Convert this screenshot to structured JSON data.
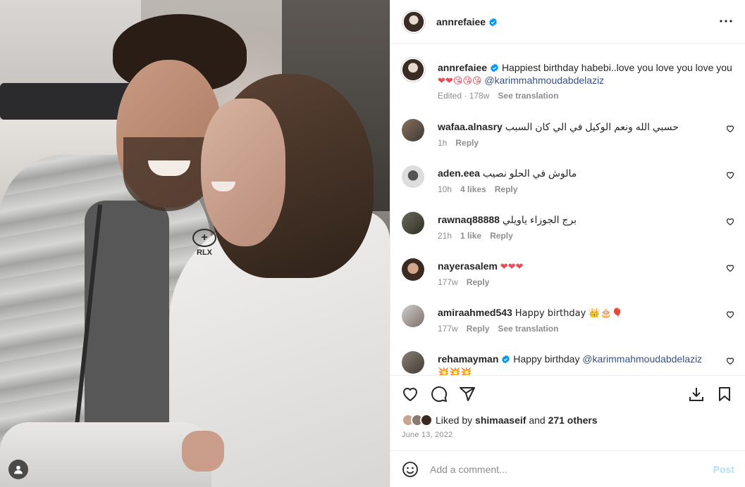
{
  "post": {
    "author": "annrefaiee",
    "caption": {
      "text": "Happiest birthday habebi..love you love you love you",
      "emojis": "❤❤😘😘😘",
      "mention": "@karimmahmoudabdelaziz",
      "edited": "Edited · 178w",
      "see_translation": "See translation"
    },
    "date": "June 13, 2022",
    "likes": {
      "liked_by_prefix": "Liked by",
      "liked_by_user": "shimaaseif",
      "and": "and",
      "others": "271 others"
    }
  },
  "comments": [
    {
      "user": "wafaa.alnasry",
      "text": "حسبي الله ونعم الوكيل في الي كان السبب",
      "time": "1h",
      "likes": "",
      "reply": "Reply",
      "translation": ""
    },
    {
      "user": "aden.eea",
      "text": "مالوش في الحلو نصيب",
      "time": "10h",
      "likes": "4 likes",
      "reply": "Reply",
      "translation": ""
    },
    {
      "user": "rawnaq88888",
      "text": "برج الجوزاء ياويلي",
      "time": "21h",
      "likes": "1 like",
      "reply": "Reply",
      "translation": ""
    },
    {
      "user": "nayerasalem",
      "text": "❤❤❤",
      "time": "177w",
      "likes": "",
      "reply": "Reply",
      "translation": ""
    },
    {
      "user": "amiraahmed543",
      "text": "Happy birthday 👑🎂🎈",
      "time": "177w",
      "likes": "",
      "reply": "Reply",
      "translation": "See translation"
    },
    {
      "user": "rehamayman",
      "text": "Happy birthday",
      "mention": "@karimmahmoudabdelaziz",
      "emojis": "💥💥💥",
      "time": "",
      "likes": "",
      "reply": "",
      "translation": ""
    }
  ],
  "add_comment": {
    "placeholder": "Add a comment...",
    "post_label": "Post"
  },
  "colors": {
    "verified": "#0095f6",
    "heart_red": "#ed4956",
    "mention": "#385185",
    "post_disabled": "#b2dffc",
    "muted": "#8e8e8e"
  },
  "icons": [
    "verified-icon",
    "more-icon",
    "heart-icon",
    "comment-icon",
    "share-icon",
    "save-icon",
    "emoji-icon",
    "user-icon"
  ]
}
